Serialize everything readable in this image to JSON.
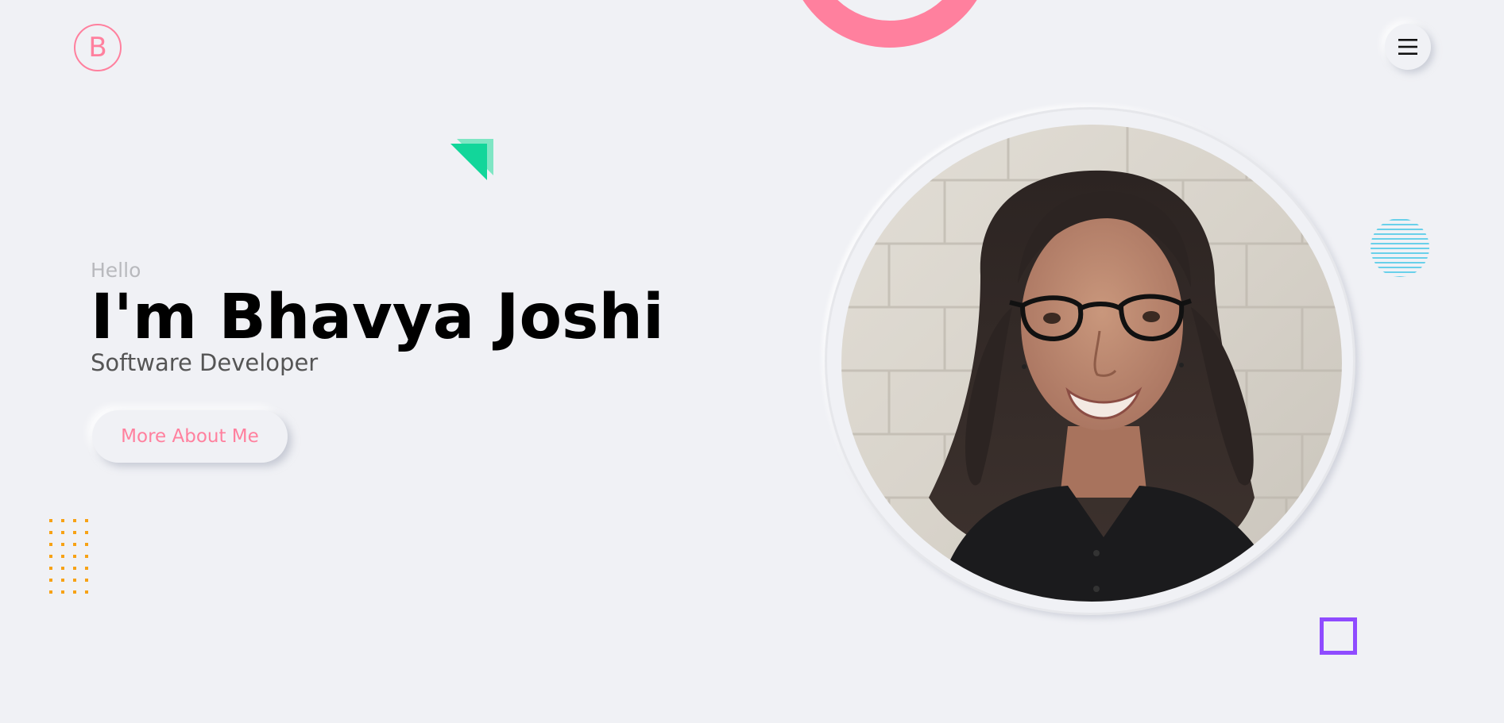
{
  "brand": {
    "logo_letter": "B",
    "accent_color": "#ff809e"
  },
  "menu": {
    "icon": "hamburger-menu-icon"
  },
  "hero": {
    "greeting": "Hello",
    "headline": "I'm Bhavya Joshi",
    "role": "Software Developer",
    "cta_label": "More About Me"
  },
  "portrait": {
    "alt": "Portrait photo"
  },
  "decorations": {
    "ring_color": "#ff809e",
    "triangle_color": "#12d69a",
    "stripes_color": "#3cc6e6",
    "dots_color": "#f7a215",
    "square_color": "#8f4bff"
  }
}
